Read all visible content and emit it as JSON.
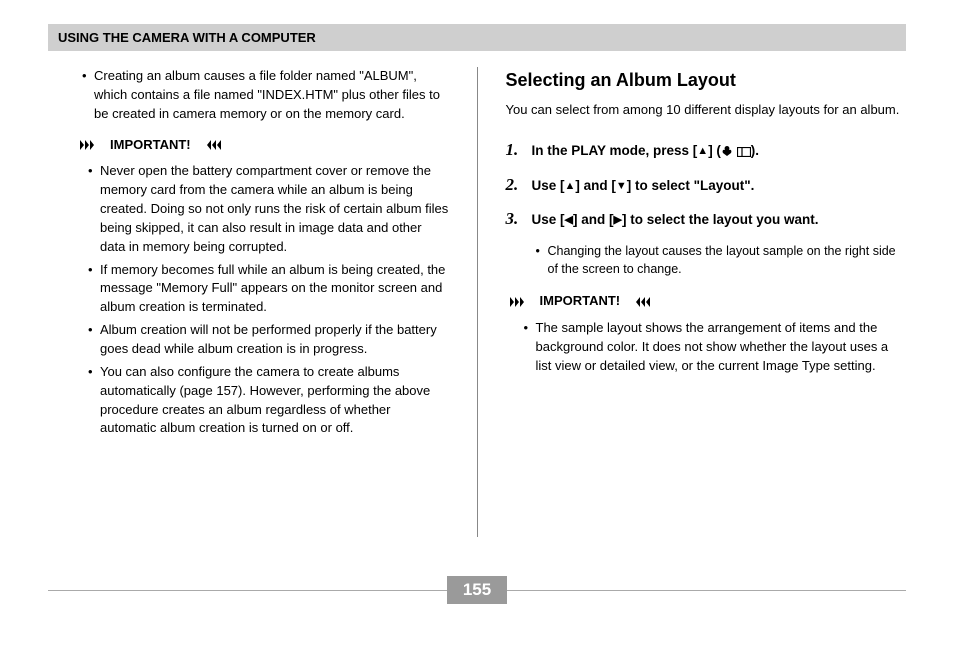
{
  "header": {
    "title": "USING THE CAMERA WITH A COMPUTER"
  },
  "left": {
    "bullet1": "Creating an album causes a file folder named \"ALBUM\", which contains a file named \"INDEX.HTM\" plus other files to be created in camera memory or on the memory card.",
    "important_label": "IMPORTANT!",
    "items": [
      "Never open the battery compartment cover or remove the memory card from the camera while an album is being created. Doing so not only runs the risk of certain album files being skipped, it can also result in image data and other data in memory being corrupted.",
      "If memory becomes full while an album is being created, the message \"Memory Full\" appears on the monitor screen and album creation is terminated.",
      "Album creation will not be performed properly if the battery goes dead while album creation is in progress.",
      "You can also configure the camera to create albums automatically (page 157). However, performing the above procedure creates an album regardless of whether automatic album creation is turned on or off."
    ]
  },
  "right": {
    "title": "Selecting an Album Layout",
    "intro": "You can select from among 10 different display layouts for an album.",
    "steps": [
      {
        "num": "1.",
        "text_pre": "In the PLAY mode, press [",
        "arrow": "▲",
        "text_post": "] (",
        "text_end": ")."
      },
      {
        "num": "2.",
        "text_pre": "Use [",
        "a1": "▲",
        "mid": "] and [",
        "a2": "▼",
        "text_post": "] to select \"Layout\"."
      },
      {
        "num": "3.",
        "text_pre": "Use [",
        "a1": "◀",
        "mid": "] and [",
        "a2": "▶",
        "text_post": "] to select the layout you want."
      }
    ],
    "step3_sub": "Changing the layout causes the layout sample on the right side of the screen to change.",
    "important_label": "IMPORTANT!",
    "imp_item": "The sample layout shows the arrangement of items and the background color. It does not show whether the layout uses a list view or detailed view, or the current Image Type setting."
  },
  "page_number": "155"
}
